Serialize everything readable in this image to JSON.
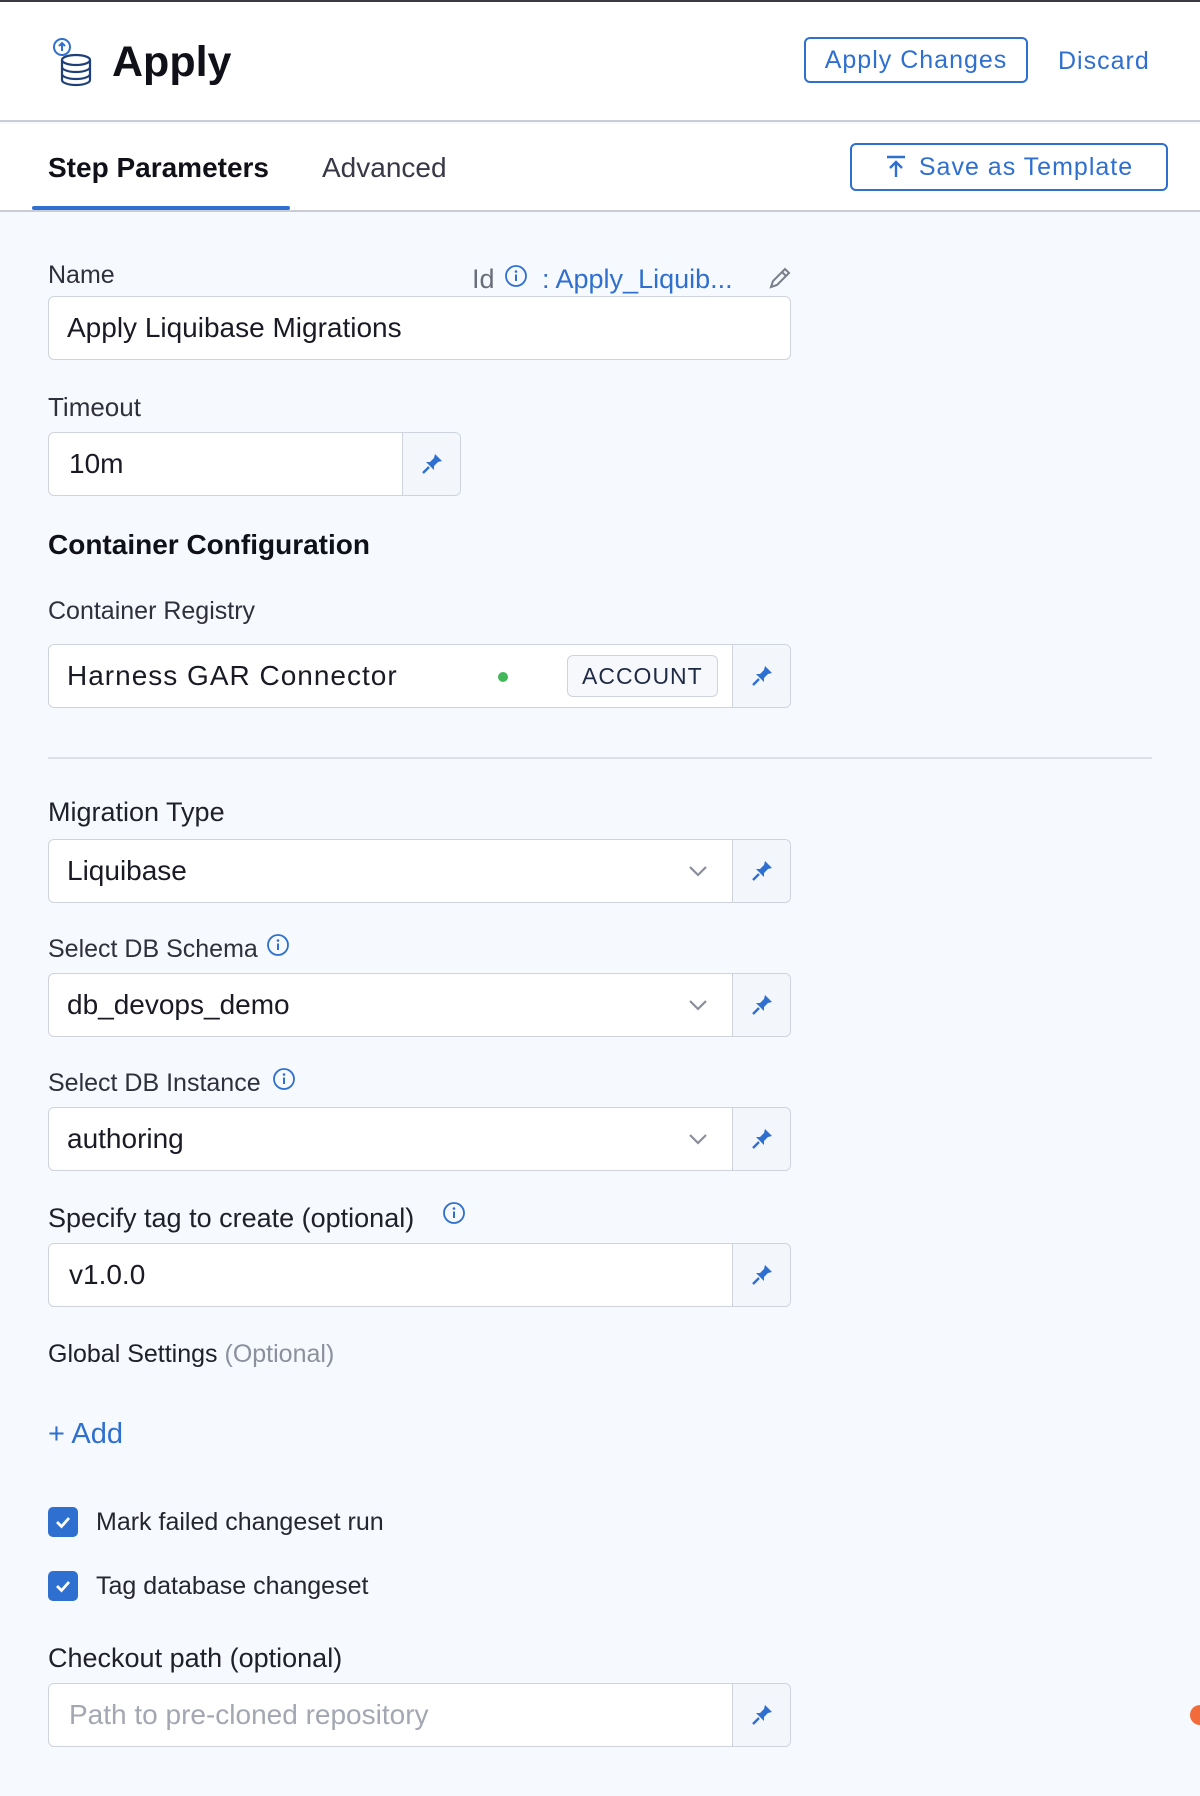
{
  "header": {
    "title": "Apply",
    "icon": "database-apply-icon",
    "apply_changes_label": "Apply Changes",
    "discard_label": "Discard"
  },
  "tabs": {
    "items": [
      {
        "label": "Step Parameters",
        "active": true
      },
      {
        "label": "Advanced",
        "active": false
      }
    ],
    "save_template_label": "Save as Template"
  },
  "form": {
    "name": {
      "label": "Name",
      "value": "Apply Liquibase Migrations",
      "id_label": "Id",
      "id_value": ": Apply_Liquib..."
    },
    "timeout": {
      "label": "Timeout",
      "value": "10m"
    },
    "container_section_title": "Container Configuration",
    "container_registry": {
      "label": "Container Registry",
      "value": "Harness GAR Connector",
      "scope_badge": "ACCOUNT",
      "status_color": "#42b85a"
    },
    "migration_type": {
      "label": "Migration Type",
      "value": "Liquibase"
    },
    "db_schema": {
      "label": "Select DB Schema",
      "value": "db_devops_demo"
    },
    "db_instance": {
      "label": "Select DB Instance",
      "value": "authoring"
    },
    "tag": {
      "label": "Specify tag to create (optional)",
      "value": "v1.0.0"
    },
    "global_settings": {
      "label": "Global Settings",
      "optional": "(Optional)",
      "add_label": "+ Add"
    },
    "checkboxes": [
      {
        "label": "Mark failed changeset run",
        "checked": true
      },
      {
        "label": "Tag database changeset",
        "checked": true
      }
    ],
    "checkout_path": {
      "label": "Checkout path (optional)",
      "placeholder": "Path to pre-cloned repository"
    }
  },
  "colors": {
    "accent": "#2e6fd0",
    "background": "#f6f9fd",
    "status_green": "#42b85a",
    "notification_orange": "#f26b3a"
  }
}
